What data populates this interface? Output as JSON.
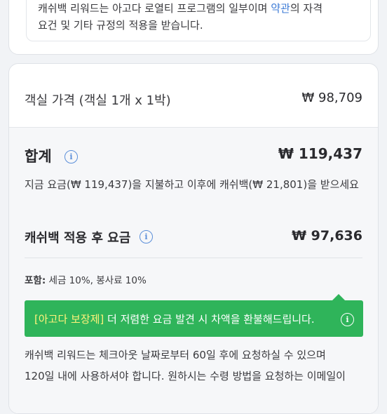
{
  "top_notice": {
    "line1_prefix": "캐쉬백 리워드는 아고다 로열티 프로그램의 일부이며 ",
    "line1_link": "약관",
    "line1_suffix": "의 자격",
    "line2": "요건 및 기타 규정의 적용을 받습니다."
  },
  "price": {
    "room_label": "객실 가격 (객실 1개 x 1박)",
    "room_value": "₩ 98,709",
    "total_label": "합계",
    "total_value": "₩ 119,437",
    "pay_note": "지금 요금(₩ 119,437)을 지불하고 이후에 캐쉬백(₩ 21,801)을 받으세요",
    "cashback_label": "캐쉬백 적용 후 요금",
    "cashback_value": "₩ 97,636",
    "includes_label": "포함:",
    "includes_value": " 세금 10%, 봉사료 10%"
  },
  "guarantee_banner": {
    "tag": "[아고다 보장제]",
    "text": " 더 저렴한 요금 발견 시 차액을 환불해드립니다."
  },
  "reward_note": {
    "line1": "캐쉬백 리워드는 체크아웃 날짜로부터 60일 후에 요청하실 수 있으며",
    "line2": "120일 내에 사용하셔야 합니다. 원하시는 수령 방법을 요청하는 이메일이"
  },
  "colors": {
    "link": "#3d7bd6",
    "banner_green": "#2fb45a",
    "banner_tag": "#fff27a"
  }
}
